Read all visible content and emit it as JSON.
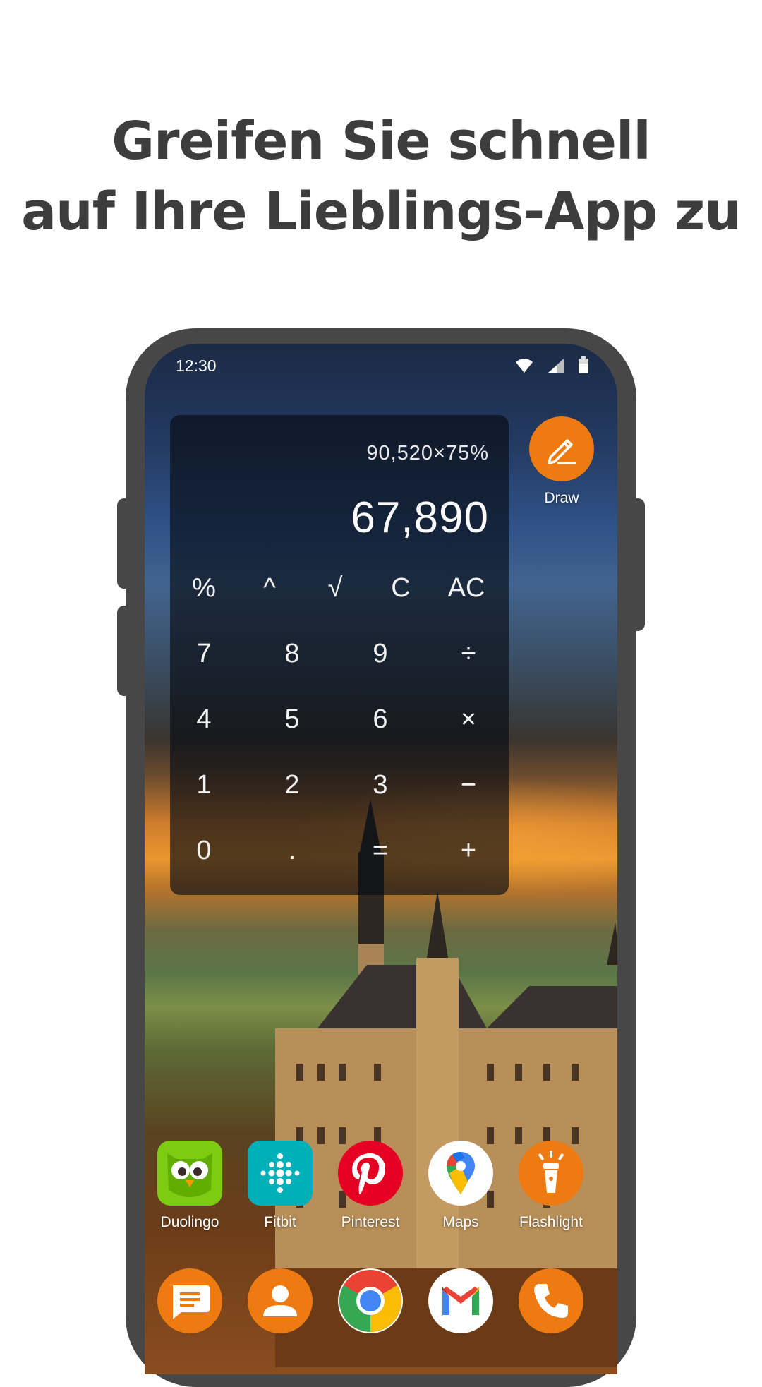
{
  "headline": {
    "line1": "Greifen Sie schnell",
    "line2": "auf Ihre Lieblings-App zu"
  },
  "status_bar": {
    "time": "12:30",
    "icons": [
      "wifi-icon",
      "signal-icon",
      "battery-icon"
    ]
  },
  "calculator": {
    "expression": "90,520×75%",
    "result": "67,890",
    "keys": [
      [
        "%",
        "^",
        "√",
        "C",
        "AC"
      ],
      [
        "7",
        "8",
        "9",
        "÷"
      ],
      [
        "4",
        "5",
        "6",
        "×"
      ],
      [
        "1",
        "2",
        "3",
        "−"
      ],
      [
        "0",
        ".",
        "=",
        "+"
      ]
    ]
  },
  "draw_shortcut": {
    "label": "Draw",
    "icon": "pencil-icon",
    "color": "#ee7a12"
  },
  "apps": [
    {
      "label": "Duolingo",
      "icon": "duolingo-owl-icon",
      "color": "#78c800"
    },
    {
      "label": "Fitbit",
      "icon": "fitbit-icon",
      "color": "#00b0b9"
    },
    {
      "label": "Pinterest",
      "icon": "pinterest-icon",
      "color": "#e60023"
    },
    {
      "label": "Maps",
      "icon": "maps-pin-icon",
      "color": "#ffffff"
    },
    {
      "label": "Flashlight",
      "icon": "flashlight-icon",
      "color": "#ee7a12"
    }
  ],
  "dock": [
    {
      "icon": "messages-icon",
      "color": "#ee7a12"
    },
    {
      "icon": "contacts-icon",
      "color": "#ee7a12"
    },
    {
      "icon": "chrome-icon",
      "color": "#ffffff"
    },
    {
      "icon": "gmail-icon",
      "color": "#ffffff"
    },
    {
      "icon": "phone-icon",
      "color": "#ee7a12"
    }
  ]
}
